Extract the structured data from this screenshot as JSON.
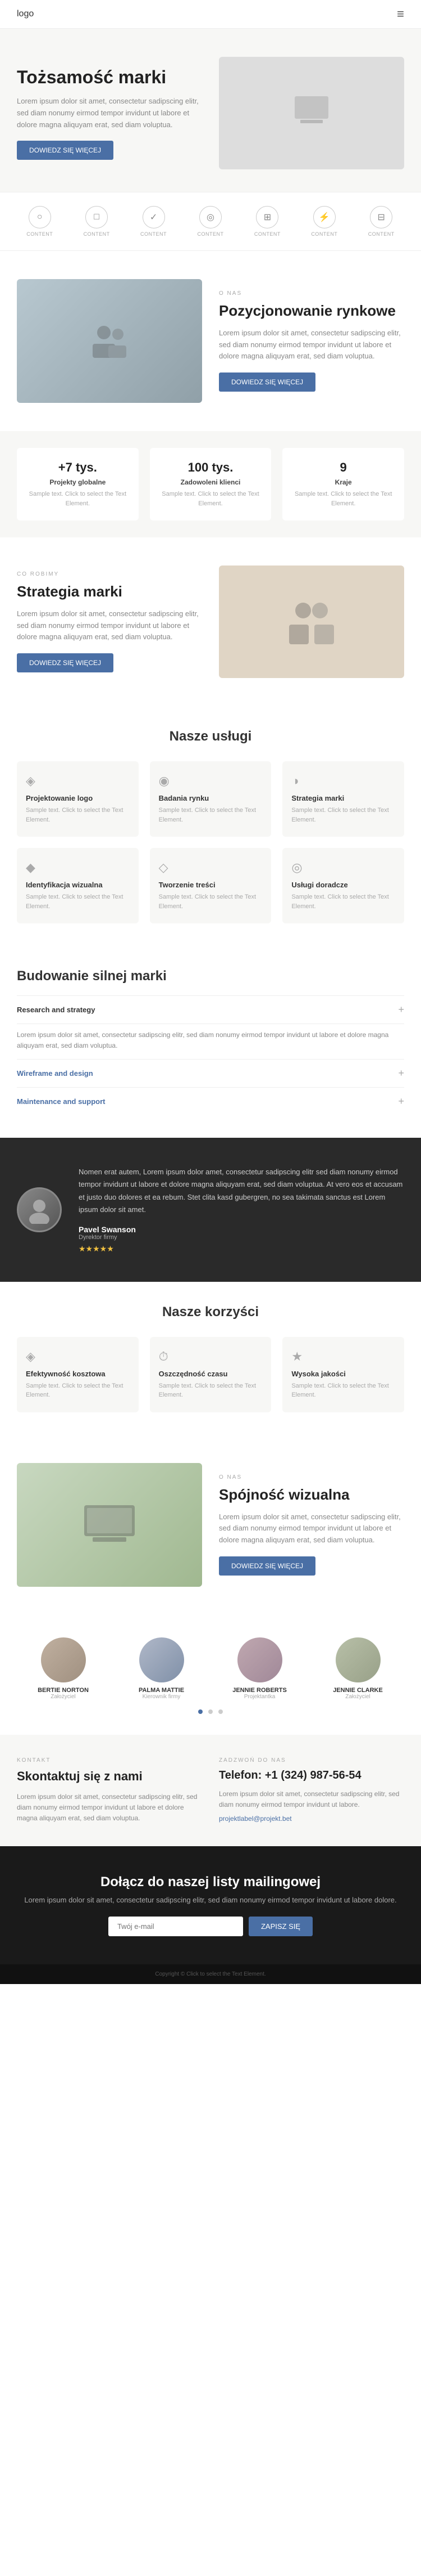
{
  "nav": {
    "logo": "logo",
    "hamburger": "≡"
  },
  "hero": {
    "title": "Tożsamość marki",
    "description": "Lorem ipsum dolor sit amet, consectetur sadipscing elitr, sed diam nonumy eirmod tempor invidunt ut labore et dolore magna aliquyam erat, sed diam voluptua.",
    "button": "DOWIEDZ SIĘ WIĘCEJ"
  },
  "icons": [
    {
      "label": "CONTENT",
      "symbol": "○"
    },
    {
      "label": "CONTENT",
      "symbol": "□"
    },
    {
      "label": "CONTENT",
      "symbol": "✓"
    },
    {
      "label": "CONTENT",
      "symbol": "◎"
    },
    {
      "label": "CONTENT",
      "symbol": "⊞"
    },
    {
      "label": "CONTENT",
      "symbol": "⚡"
    },
    {
      "label": "CONTENT",
      "symbol": "⊟"
    }
  ],
  "about": {
    "label": "O NAS",
    "title": "Pozycjonowanie rynkowe",
    "description": "Lorem ipsum dolor sit amet, consectetur sadipscing elitr, sed diam nonumy eirmod tempor invidunt ut labore et dolore magna aliquyam erat, sed diam voluptua.",
    "button": "DOWIEDZ SIĘ WIĘCEJ"
  },
  "stats": [
    {
      "num": "+7 tys.",
      "label": "Projekty globalne",
      "desc": "Sample text. Click to select the Text Element."
    },
    {
      "num": "100 tys.",
      "label": "Zadowoleni klienci",
      "desc": "Sample text. Click to select the Text Element."
    },
    {
      "num": "9",
      "label": "Kraje",
      "desc": "Sample text. Click to select the Text Element."
    }
  ],
  "strategy": {
    "label": "CO ROBIMY",
    "title": "Strategia marki",
    "description": "Lorem ipsum dolor sit amet, consectetur sadipscing elitr, sed diam nonumy eirmod tempor invidunt ut labore et dolore magna aliquyam erat, sed diam voluptua.",
    "button": "DOWIEDZ SIĘ WIĘCEJ"
  },
  "services": {
    "title": "Nasze usługi",
    "items": [
      {
        "icon": "◈",
        "title": "Projektowanie logo",
        "desc": "Sample text. Click to select the Text Element."
      },
      {
        "icon": "◉",
        "title": "Badania rynku",
        "desc": "Sample text. Click to select the Text Element."
      },
      {
        "icon": "◑",
        "title": "Strategia marki",
        "desc": "Sample text. Click to select the Text Element."
      },
      {
        "icon": "◆",
        "title": "Identyfikacja wizualna",
        "desc": "Sample text. Click to select the Text Element."
      },
      {
        "icon": "◇",
        "title": "Tworzenie treści",
        "desc": "Sample text. Click to select the Text Element."
      },
      {
        "icon": "◎",
        "title": "Usługi doradcze",
        "desc": "Sample text. Click to select the Text Element."
      }
    ]
  },
  "brand_build": {
    "title": "Budowanie silnej marki",
    "items": [
      {
        "title": "Research and strategy",
        "content": "Lorem ipsum dolor sit amet, consectetur sadipscing elitr, sed diam nonumy eirmod tempor invidunt ut labore et dolore magna aliquyam erat, sed diam voluptua."
      },
      {
        "title": "Wireframe and design",
        "content": ""
      },
      {
        "title": "Maintenance and support",
        "content": ""
      }
    ]
  },
  "testimonial": {
    "text": "Nomen erat autem, Lorem ipsum dolor amet, consectetur sadipscing elitr sed diam nonumy eirmod tempor invidunt ut labore et dolore magna aliquyam erat, sed diam voluptua. At vero eos et accusam et justo duo dolores et ea rebum. Stet clita kasd gubergren, no sea takimata sanctus est Lorem ipsum dolor sit amet.",
    "name": "Pavel Swanson",
    "role": "Dyrektor firmy",
    "stars": "★★★★★"
  },
  "benefits": {
    "title": "Nasze korzyści",
    "items": [
      {
        "icon": "◈",
        "title": "Efektywność kosztowa",
        "desc": "Sample text. Click to select the Text Element."
      },
      {
        "icon": "⏱",
        "title": "Oszczędność czasu",
        "desc": "Sample text. Click to select the Text Element."
      },
      {
        "icon": "★",
        "title": "Wysoka jakości",
        "desc": "Sample text. Click to select the Text Element."
      }
    ]
  },
  "visual": {
    "label": "O NAS",
    "title": "Spójność wizualna",
    "description": "Lorem ipsum dolor sit amet, consectetur sadipscing elitr, sed diam nonumy eirmod tempor invidunt ut labore et dolore magna aliquyam erat, sed diam voluptua.",
    "button": "DOWIEDZ SIĘ WIĘCEJ"
  },
  "team": {
    "members": [
      {
        "name": "BERTIE NORTON",
        "role": "Założyciel"
      },
      {
        "name": "PALMA MATTIE",
        "role": "Kierownik firmy"
      },
      {
        "name": "JENNIE ROBERTS",
        "role": "Projektantka"
      },
      {
        "name": "JENNIE CLARKE",
        "role": "Założyciel"
      }
    ]
  },
  "contact": {
    "label_left": "KONTAKT",
    "title_left": "Skontaktuj się z nami",
    "desc_left": "Lorem ipsum dolor sit amet, consectetur sadipscing elitr, sed diam nonumy eirmod tempor invidunt ut labore et dolore magna aliquyam erat, sed diam voluptua.",
    "label_right": "ZADZWOŃ DO NAS",
    "phone": "Telefon: +1 (324) 987-56-54",
    "desc_right": "Lorem ipsum dolor sit amet, consectetur sadipscing elitr, sed diam nonumy eirmod tempor invidunt ut labore.",
    "email": "projektlabel@projekt.bet"
  },
  "newsletter": {
    "title": "Dołącz do naszej listy mailingowej",
    "desc": "Lorem ipsum dolor sit amet, consectetur sadipscing elitr, sed diam nonumy eirmod tempor invidunt ut labore dolore.",
    "placeholder": "Twój e-mail",
    "button": "ZAPISZ SIĘ"
  },
  "footer": {
    "text": "Copyright © Click to select the Text Element."
  }
}
